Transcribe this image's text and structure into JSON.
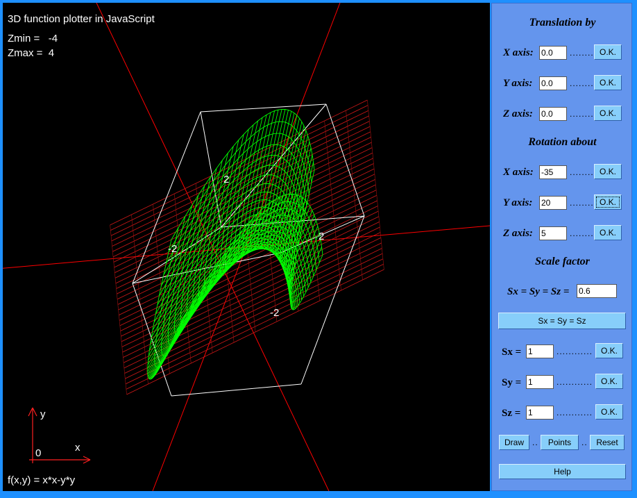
{
  "canvas": {
    "title": "3D function plotter in JavaScript",
    "zmin_label": "Zmin =   -4",
    "zmax_label": "Zmax =  4",
    "axis_y": "y",
    "axis_x": "x",
    "axis_origin": "0",
    "formula": "f(x,y) = x*x-y*y",
    "tick_labels": [
      "2",
      "-2",
      "2",
      "-2"
    ],
    "colors": {
      "background": "#000000",
      "surface": "#00ff00",
      "axes": "#ff0000",
      "box": "#ffffff"
    }
  },
  "panel": {
    "translation_title": "Translation by",
    "rotation_title": "Rotation about",
    "scale_title": "Scale factor",
    "x_axis": "X axis:",
    "y_axis": "Y axis:",
    "z_axis": "Z axis:",
    "ok": "O.K.",
    "dots": "........",
    "dots_long": "............",
    "translation": {
      "x": "0.0",
      "y": "0.0",
      "z": "0.0"
    },
    "rotation": {
      "x": "-35",
      "y": "20",
      "z": "5"
    },
    "scale_label": "Sx = Sy = Sz =",
    "scale_value": "0.6",
    "scale_button": "Sx = Sy = Sz",
    "sx_label": "Sx =",
    "sy_label": "Sy =",
    "sz_label": "Sz =",
    "sx": "1",
    "sy": "1",
    "sz": "1",
    "draw": "Draw",
    "points": "Points",
    "reset": "Reset",
    "sep": "..",
    "help": "Help"
  }
}
